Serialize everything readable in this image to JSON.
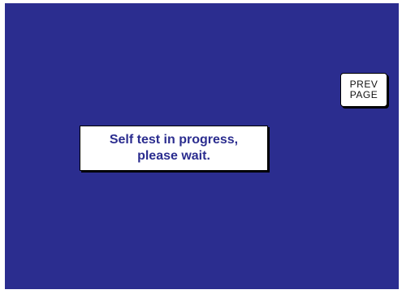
{
  "screen": {
    "background_color": "#2b2d8f"
  },
  "prev_page_button": {
    "line1": "PREV",
    "line2": "PAGE"
  },
  "status": {
    "line1": "Self test in progress,",
    "line2": "please wait.",
    "text_color": "#2b2d8f"
  }
}
